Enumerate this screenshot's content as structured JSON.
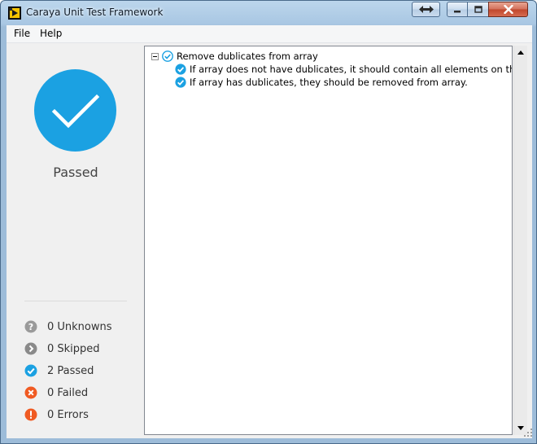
{
  "window": {
    "title": "Caraya Unit Test Framework"
  },
  "menu": {
    "file": "File",
    "help": "Help"
  },
  "summary": {
    "status": "Passed",
    "status_color": "#1ba1e2",
    "stats": [
      {
        "label": "0 Unknowns",
        "icon": "question-icon",
        "color": "#9a9a9a"
      },
      {
        "label": "0 Skipped",
        "icon": "skip-icon",
        "color": "#8a8a8a"
      },
      {
        "label": "2 Passed",
        "icon": "check-icon",
        "color": "#1ba1e2"
      },
      {
        "label": "0 Failed",
        "icon": "x-icon",
        "color": "#f05a22"
      },
      {
        "label": "0 Errors",
        "icon": "error-icon",
        "color": "#f05a22"
      }
    ]
  },
  "tree": {
    "suite": "Remove dublicates from array",
    "tests": [
      "If array does not have dublicates, it should contain all elements on the outpu",
      "If array has dublicates, they should be removed from array."
    ]
  }
}
